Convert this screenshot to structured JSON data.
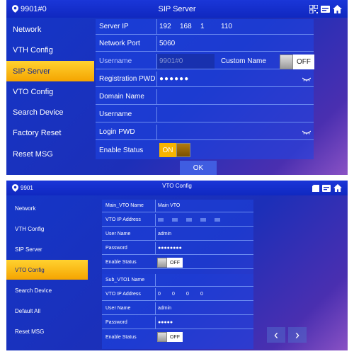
{
  "panel1": {
    "title": "SIP Server",
    "device_id": "9901#0",
    "sidebar": [
      "Network",
      "VTH Config",
      "SIP Server",
      "VTO Config",
      "Search Device",
      "Factory Reset",
      "Reset MSG"
    ],
    "active_index": 2,
    "fields": {
      "server_ip_label": "Server IP",
      "server_ip": [
        "192",
        "168",
        "1",
        "110"
      ],
      "network_port_label": "Network Port",
      "network_port": "5060",
      "username_label": "Username",
      "username_value": "9901#0",
      "custom_name_label": "Custom Name",
      "custom_name_toggle": "OFF",
      "registration_pwd_label": "Registration PWD",
      "registration_pwd": "●●●●●●",
      "domain_name_label": "Domain Name",
      "username2_label": "Username",
      "login_pwd_label": "Login PWD",
      "enable_status_label": "Enable Status",
      "enable_status_toggle": "ON"
    },
    "ok_label": "OK"
  },
  "panel2": {
    "title": "VTO Config",
    "device_id": "9901",
    "sidebar": [
      "Network",
      "VTH Config",
      "SIP Server",
      "VTO Config",
      "Search Device",
      "Default All",
      "Reset MSG"
    ],
    "active_index": 3,
    "main_vto": {
      "name_label": "Main_VTO Name",
      "name_value": "Main VTO",
      "ip_label": "VTO IP Address",
      "user_label": "User Name",
      "user_value": "admin",
      "password_label": "Password",
      "password_value": "●●●●●●●●",
      "enable_label": "Enable Status",
      "enable_toggle": "OFF"
    },
    "sub_vto": {
      "name_label": "Sub_VTO1 Name",
      "ip_label": "VTO IP Address",
      "ip": [
        "0",
        "0",
        "0",
        "0"
      ],
      "user_label": "User Name",
      "user_value": "admin",
      "password_label": "Password",
      "password_value": "●●●●●",
      "enable_label": "Enable Status",
      "enable_toggle": "OFF"
    },
    "prev_label": "‹",
    "next_label": "›"
  },
  "colors": {
    "active": "#f5a400",
    "panel": "#1c2fb8",
    "on_toggle": "#f6b400"
  }
}
